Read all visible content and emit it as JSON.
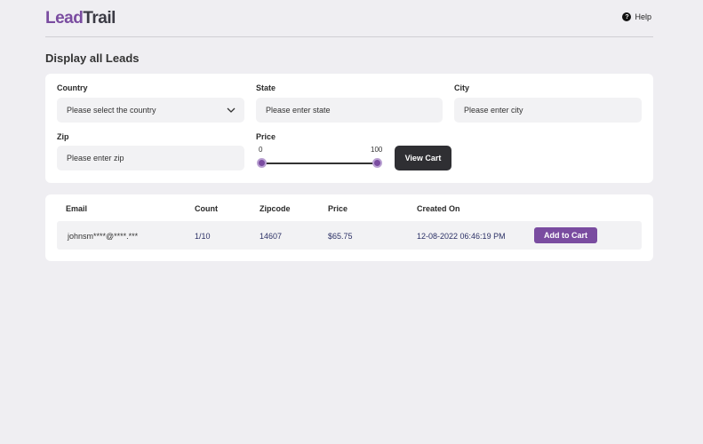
{
  "app": {
    "logo_lead": "Lead",
    "logo_trail": "Trail"
  },
  "header": {
    "help_label": "Help"
  },
  "page": {
    "title": "Display all Leads"
  },
  "filters": {
    "country": {
      "label": "Country",
      "placeholder": "Please select the country"
    },
    "state": {
      "label": "State",
      "placeholder": "Please enter state"
    },
    "city": {
      "label": "City",
      "placeholder": "Please enter city"
    },
    "zip": {
      "label": "Zip",
      "placeholder": "Please enter zip"
    },
    "price": {
      "label": "Price",
      "min": "0",
      "max": "100"
    },
    "view_cart_label": "View Cart"
  },
  "table": {
    "columns": [
      "Email",
      "Count",
      "Zipcode",
      "Price",
      "Created On"
    ],
    "rows": [
      {
        "email": "johnsm****@****.***",
        "count": "1/10",
        "zipcode": "14607",
        "price": "$65.75",
        "created_on": "12-08-2022 06:46:19 PM",
        "action_label": "Add to Cart"
      }
    ]
  },
  "colors": {
    "accent": "#7a4ca0",
    "dark_button": "#2f2f33",
    "background": "#efeef2"
  }
}
